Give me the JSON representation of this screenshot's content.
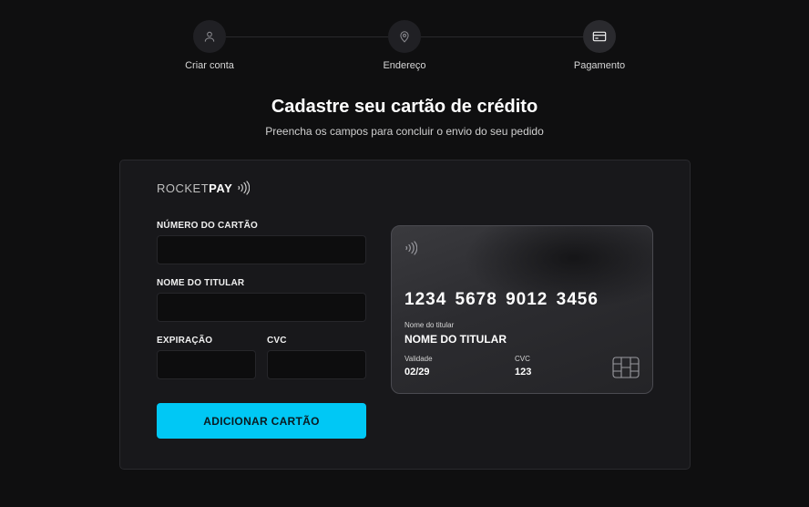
{
  "stepper": {
    "steps": [
      {
        "label": "Criar conta",
        "icon": "user-icon"
      },
      {
        "label": "Endereço",
        "icon": "map-pin-icon"
      },
      {
        "label": "Pagamento",
        "icon": "credit-card-icon"
      }
    ]
  },
  "header": {
    "title": "Cadastre seu cartão de crédito",
    "subtitle": "Preencha os campos para concluir o envio do seu pedido"
  },
  "brand": {
    "name_light": "ROCKET",
    "name_bold": "PAY",
    "icon": "contactless-icon"
  },
  "form": {
    "card_number_label": "NÚMERO DO CARTÃO",
    "card_number_value": "",
    "holder_label": "NOME DO TITULAR",
    "holder_value": "",
    "expiration_label": "EXPIRAÇÃO",
    "expiration_value": "",
    "cvc_label": "CVC",
    "cvc_value": "",
    "submit_label": "ADICIONAR CARTÃO"
  },
  "card_preview": {
    "number": "1234 5678 9012 3456",
    "holder_label": "Nome do titular",
    "holder": "NOME DO TITULAR",
    "expiration_label": "Validade",
    "expiration": "02/29",
    "cvc_label": "CVC",
    "cvc": "123",
    "icons": [
      "contactless-icon",
      "chip-icon"
    ]
  },
  "colors": {
    "background": "#0f0f10",
    "panel": "#18181b",
    "accent": "#00c8f5"
  }
}
